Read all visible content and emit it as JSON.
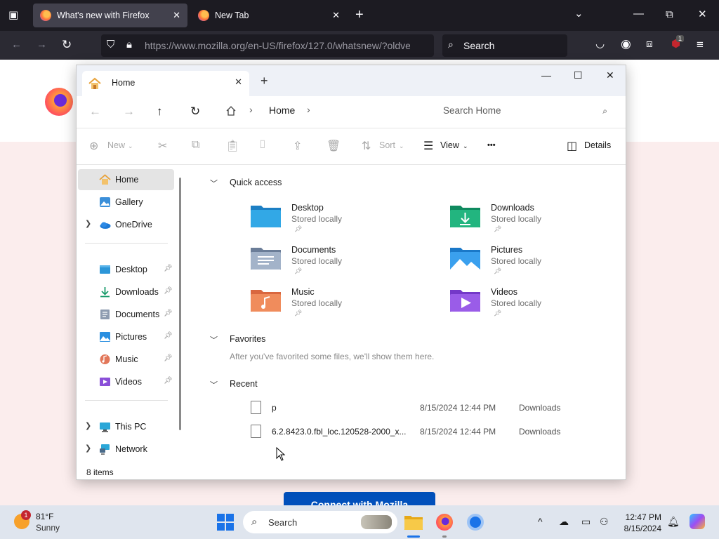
{
  "firefox": {
    "tabs": [
      {
        "title": "What's new with Firefox",
        "active": true
      },
      {
        "title": "New Tab",
        "active": false
      }
    ],
    "url": "https://www.mozilla.org/en-US/firefox/127.0/whatsnew/?oldve",
    "search_placeholder": "Search",
    "extension_badge": "1"
  },
  "page": {
    "cta_label": "Connect with Mozilla"
  },
  "explorer": {
    "tab_title": "Home",
    "breadcrumb": "Home",
    "search_placeholder": "Search Home",
    "toolbar": {
      "new": "New",
      "sort": "Sort",
      "view": "View",
      "more": "•••",
      "details": "Details"
    },
    "nav": {
      "top": [
        {
          "label": "Home",
          "icon": "home-icon"
        },
        {
          "label": "Gallery",
          "icon": "gallery-icon"
        },
        {
          "label": "OneDrive",
          "icon": "onedrive-icon"
        }
      ],
      "pinned": [
        {
          "label": "Desktop",
          "icon": "desktop-icon"
        },
        {
          "label": "Downloads",
          "icon": "downloads-icon"
        },
        {
          "label": "Documents",
          "icon": "documents-icon"
        },
        {
          "label": "Pictures",
          "icon": "pictures-icon"
        },
        {
          "label": "Music",
          "icon": "music-icon"
        },
        {
          "label": "Videos",
          "icon": "videos-icon"
        }
      ],
      "bottom": [
        {
          "label": "This PC",
          "icon": "this-pc-icon"
        },
        {
          "label": "Network",
          "icon": "network-icon"
        }
      ]
    },
    "sections": {
      "quick_access": "Quick access",
      "favorites": "Favorites",
      "favorites_empty": "After you've favorited some files, we'll show them here.",
      "recent": "Recent"
    },
    "quick_access": [
      {
        "name": "Desktop",
        "sub": "Stored locally"
      },
      {
        "name": "Downloads",
        "sub": "Stored locally"
      },
      {
        "name": "Documents",
        "sub": "Stored locally"
      },
      {
        "name": "Pictures",
        "sub": "Stored locally"
      },
      {
        "name": "Music",
        "sub": "Stored locally"
      },
      {
        "name": "Videos",
        "sub": "Stored locally"
      }
    ],
    "recent": [
      {
        "name": "p",
        "date": "8/15/2024 12:44 PM",
        "location": "Downloads"
      },
      {
        "name": "6.2.8423.0.fbl_loc.120528-2000_x...",
        "date": "8/15/2024 12:44 PM",
        "location": "Downloads"
      }
    ],
    "status": "8 items"
  },
  "taskbar": {
    "weather_temp": "81°F",
    "weather_cond": "Sunny",
    "weather_badge": "1",
    "search": "Search",
    "time": "12:47 PM",
    "date": "8/15/2024"
  }
}
